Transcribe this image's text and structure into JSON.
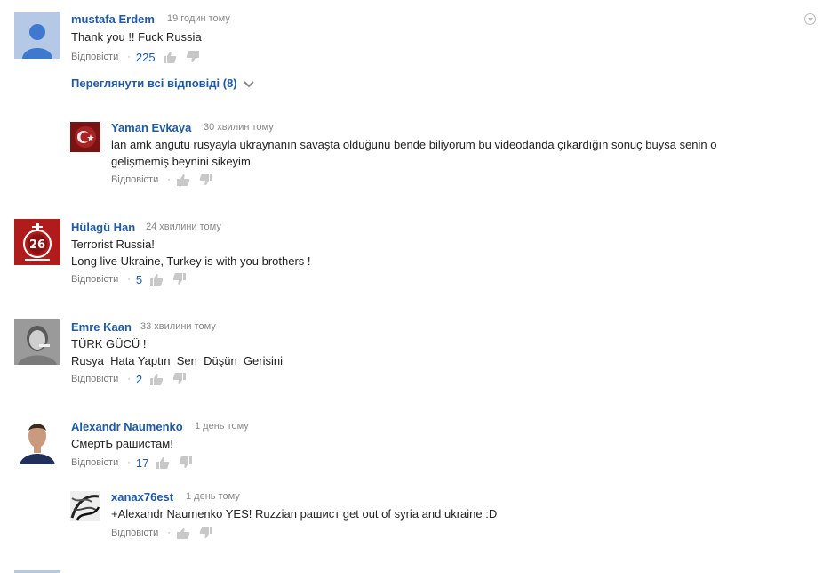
{
  "comments": [
    {
      "author": "mustafa Erdem",
      "time": "19 годин тому",
      "lines": [
        "Thank you !! Fuck Russia"
      ],
      "reply_label": "Відповісти",
      "likes": "225",
      "view_replies": "Переглянути всі відповіді (8)"
    },
    {
      "author": "Yaman Evkaya",
      "time": "30 хвилин тому",
      "lines": [
        "lan amk angutu rusyayla ukraynanın savaşta olduğunu bende biliyorum bu videodanda çıkardığın sonuç buysa senin o",
        "gelişmemiş beynini sikeyim"
      ],
      "reply_label": "Відповісти",
      "likes": ""
    },
    {
      "author": "Hülagü Han",
      "time": "24 хвилини тому",
      "lines": [
        "Terrorist Russia!",
        "Long live Ukraine, Turkey is with you brothers !"
      ],
      "reply_label": "Відповісти",
      "likes": "5"
    },
    {
      "author": "Emre Kaan",
      "time": "33 хвилини тому",
      "lines": [
        "TÜRK GÜCÜ !",
        "Rusya  Hata Yaptın  Sen  Düşün  Gerisini"
      ],
      "reply_label": "Відповісти",
      "likes": "2"
    },
    {
      "author": "Alexandr Naumenko",
      "time": "1 день тому",
      "lines": [
        "СмертЬ рашистам!"
      ],
      "reply_label": "Відповісти",
      "likes": "17"
    },
    {
      "author": "xanax76est",
      "time": "1 день тому",
      "lines": [
        "+Alexandr Naumenko YES! Ruzzian рашист get out of syria and ukraine :D"
      ],
      "reply_label": "Відповісти",
      "likes": ""
    }
  ],
  "icons": {
    "like": "thumbs-up-icon",
    "dislike": "thumbs-down-icon",
    "menu": "chevron-down-icon"
  },
  "colors": {
    "link": "#1e5aa8",
    "meta": "#888888",
    "icon": "#cccccc"
  }
}
